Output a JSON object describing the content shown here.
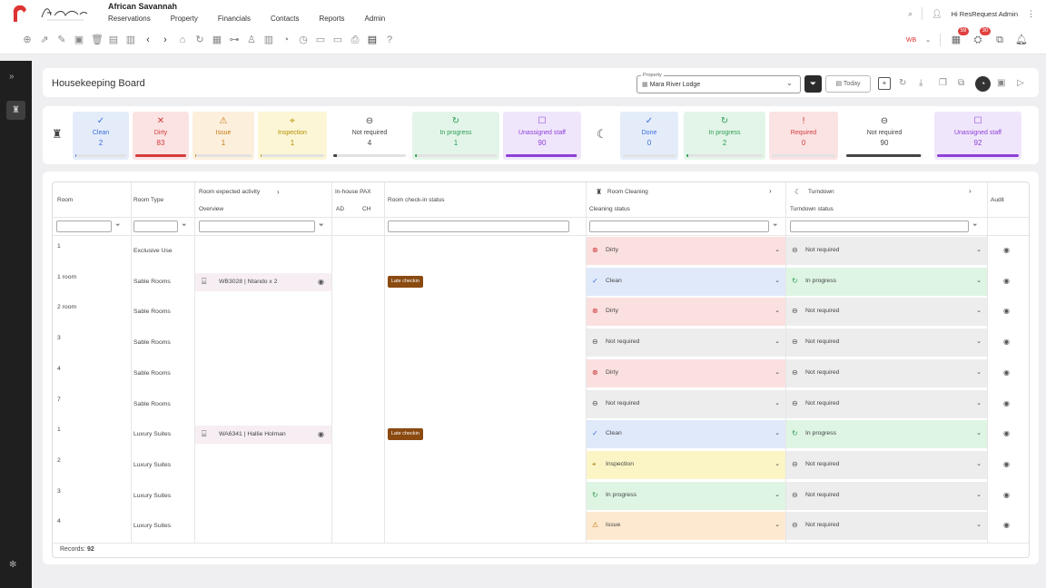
{
  "app": {
    "org": "African Savannah",
    "brand_script": "African Savannah",
    "menu": [
      "Reservations",
      "Property",
      "Financials",
      "Contacts",
      "Reports",
      "Admin"
    ],
    "greeting": "Hi ResRequest Admin",
    "user_initials": "WB",
    "badges": [
      {
        "icon": "bell-stack",
        "count": "59"
      },
      {
        "icon": "user",
        "count": "30"
      }
    ]
  },
  "page": {
    "title": "Housekeeping Board",
    "property_label": "Property",
    "property_value": "Mara River Lodge",
    "today_label": "Today"
  },
  "cleaning_stats": [
    {
      "label": "Clean",
      "value": "2",
      "color": "#3a6fd8",
      "bg": "#e4ecfa",
      "fill": 0.02,
      "icon": "✓"
    },
    {
      "label": "Dirty",
      "value": "83",
      "color": "#d33b3b",
      "bg": "#fbe3e3",
      "fill": 1.0,
      "icon": "✕"
    },
    {
      "label": "Issue",
      "value": "1",
      "color": "#c77a15",
      "bg": "#fcefdc",
      "fill": 0.02,
      "icon": "⚠"
    },
    {
      "label": "Inspection",
      "value": "1",
      "color": "#b58e00",
      "bg": "#fcf6d6",
      "fill": 0.02,
      "icon": "⌖"
    },
    {
      "label": "Not required",
      "value": "4",
      "color": "#444",
      "bg": "#ffffff",
      "fill": 0.05,
      "icon": "⊖"
    },
    {
      "label": "In progress",
      "value": "1",
      "color": "#2e9d55",
      "bg": "#e3f5e8",
      "fill": 0.02,
      "icon": "↻"
    },
    {
      "label": "Unassigned staff",
      "value": "90",
      "color": "#8e3fd8",
      "bg": "#f0e6fb",
      "fill": 0.98,
      "icon": "☐"
    }
  ],
  "turndown_stats": [
    {
      "label": "Done",
      "value": "0",
      "color": "#3a6fd8",
      "bg": "#e4ecfa",
      "fill": 0,
      "icon": "✓"
    },
    {
      "label": "In progress",
      "value": "2",
      "color": "#2e9d55",
      "bg": "#e3f5e8",
      "fill": 0.02,
      "icon": "↻"
    },
    {
      "label": "Required",
      "value": "0",
      "color": "#d33b3b",
      "bg": "#fbe3e3",
      "fill": 0,
      "icon": "!"
    },
    {
      "label": "Not required",
      "value": "90",
      "color": "#444",
      "bg": "#ffffff",
      "fill": 0.98,
      "icon": "⊖"
    },
    {
      "label": "Unassigned staff",
      "value": "92",
      "color": "#8e3fd8",
      "bg": "#f0e6fb",
      "fill": 1.0,
      "icon": "☐"
    }
  ],
  "columns": {
    "room": "Room",
    "room_type": "Room Type",
    "expected": "Room expected activity",
    "overview": "Overview",
    "pax": "In-house PAX",
    "ad": "AD",
    "ch": "CH",
    "checkin": "Room check-in status",
    "cleaning": "Room Cleaning",
    "cleaning_status": "Cleaning status",
    "turndown": "Turndown",
    "turndown_status": "Turndown status",
    "audit": "Audit"
  },
  "rows": [
    {
      "room": "1",
      "type": "Exclusive Use",
      "booking": "",
      "late": "",
      "clean": "Dirty",
      "turn": "Not required"
    },
    {
      "room": "1 room",
      "type": "Sable Rooms",
      "booking": "WB3028 | Ntando x 2",
      "late": "Late checkin",
      "clean": "Clean",
      "turn": "In progress"
    },
    {
      "room": "2 room",
      "type": "Sable Rooms",
      "booking": "",
      "late": "",
      "clean": "Dirty",
      "turn": "Not required"
    },
    {
      "room": "3",
      "type": "Sable Rooms",
      "booking": "",
      "late": "",
      "clean": "Not required",
      "turn": "Not required"
    },
    {
      "room": "4",
      "type": "Sable Rooms",
      "booking": "",
      "late": "",
      "clean": "Dirty",
      "turn": "Not required"
    },
    {
      "room": "7",
      "type": "Sable Rooms",
      "booking": "",
      "late": "",
      "clean": "Not required",
      "turn": "Not required"
    },
    {
      "room": "1",
      "type": "Luxury Suites",
      "booking": "WA6341 | Hallie Holman",
      "late": "Late checkin",
      "clean": "Clean",
      "turn": "In progress"
    },
    {
      "room": "2",
      "type": "Luxury Suites",
      "booking": "",
      "late": "",
      "clean": "Inspection",
      "turn": "Not required"
    },
    {
      "room": "3",
      "type": "Luxury Suites",
      "booking": "",
      "late": "",
      "clean": "In progress",
      "turn": "Not required"
    },
    {
      "room": "4",
      "type": "Luxury Suites",
      "booking": "",
      "late": "",
      "clean": "Issue",
      "turn": "Not required"
    }
  ],
  "status_styles": {
    "Dirty": {
      "bg": "#fbe0e0",
      "icon": "⊗",
      "color": "#c33"
    },
    "Clean": {
      "bg": "#e0e9fa",
      "icon": "✓",
      "color": "#3a6fd8"
    },
    "Not required": {
      "bg": "#ededed",
      "icon": "⊖",
      "color": "#555"
    },
    "Inspection": {
      "bg": "#fbf5c6",
      "icon": "⌖",
      "color": "#a07c00"
    },
    "In progress": {
      "bg": "#def5e3",
      "icon": "↻",
      "color": "#2e9d55"
    },
    "Issue": {
      "bg": "#fde9d0",
      "icon": "⚠",
      "color": "#c77a15"
    }
  },
  "records_label": "Records:",
  "records_count": "92"
}
